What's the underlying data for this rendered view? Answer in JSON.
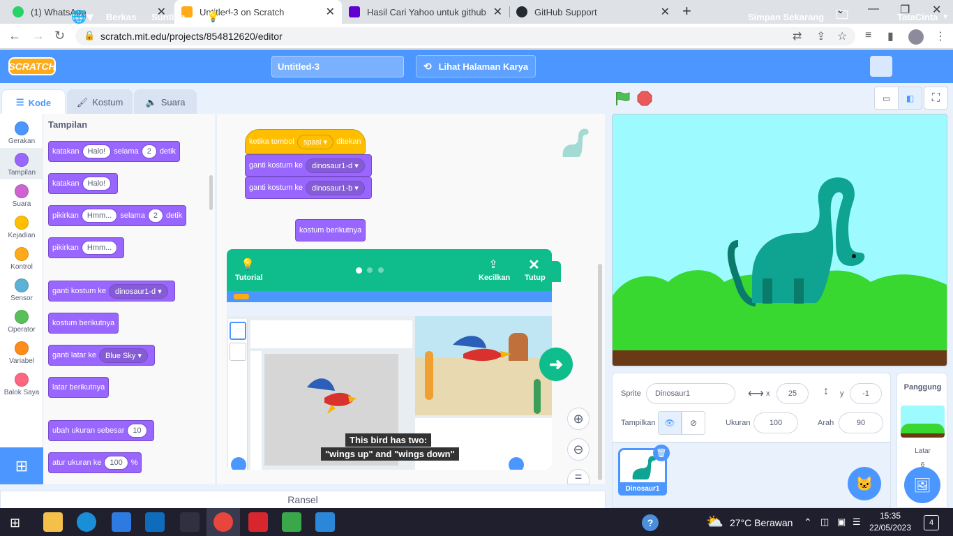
{
  "browser": {
    "tabs": [
      {
        "title": "(1) WhatsApp",
        "color": "#25d366"
      },
      {
        "title": "Untitled-3 on Scratch",
        "color": "#ffab19"
      },
      {
        "title": "Hasil Cari Yahoo untuk github log",
        "color": "#6001d2"
      },
      {
        "title": "GitHub Support",
        "color": "#24292f"
      }
    ],
    "url": "scratch.mit.edu/projects/854812620/editor"
  },
  "menu": {
    "file": "Berkas",
    "edit": "Sunting",
    "tutorial": "Tutorial",
    "project_title": "Untitled-3",
    "see_project": "Lihat Halaman Karya",
    "save_now": "Simpan Sekarang",
    "username": "TataCinta"
  },
  "editor_tabs": {
    "code": "Kode",
    "costume": "Kostum",
    "sound": "Suara"
  },
  "categories": [
    {
      "label": "Gerakan",
      "color": "#4c97ff"
    },
    {
      "label": "Tampilan",
      "color": "#9966ff"
    },
    {
      "label": "Suara",
      "color": "#cf63cf"
    },
    {
      "label": "Kejadian",
      "color": "#ffbf00"
    },
    {
      "label": "Kontrol",
      "color": "#ffab19"
    },
    {
      "label": "Sensor",
      "color": "#5cb1d6"
    },
    {
      "label": "Operator",
      "color": "#59c059"
    },
    {
      "label": "Variabel",
      "color": "#ff8c1a"
    },
    {
      "label": "Balok Saya",
      "color": "#ff6680"
    }
  ],
  "palette": {
    "heading": "Tampilan",
    "say_for": {
      "text": "katakan",
      "value": "Halo!",
      "mid": "selama",
      "secs": "2",
      "unit": "detik"
    },
    "say": {
      "text": "katakan",
      "value": "Halo!"
    },
    "think_for": {
      "text": "pikirkan",
      "value": "Hmm...",
      "mid": "selama",
      "secs": "2",
      "unit": "detik"
    },
    "think": {
      "text": "pikirkan",
      "value": "Hmm..."
    },
    "switch_costume": {
      "text": "ganti kostum ke",
      "value": "dinosaur1-d"
    },
    "next_costume": "kostum berikutnya",
    "switch_backdrop": {
      "text": "ganti latar ke",
      "value": "Blue Sky"
    },
    "next_backdrop": "latar berikutnya",
    "change_size": {
      "text": "ubah ukuran sebesar",
      "value": "10"
    },
    "set_size": {
      "text": "atur ukuran ke",
      "value": "100",
      "unit": "%"
    }
  },
  "script": {
    "hat": {
      "text": "ketika tombol",
      "key": "spasi",
      "suffix": "ditekan"
    },
    "block1": {
      "text": "ganti kostum ke",
      "value": "dinosaur1-d"
    },
    "block2": {
      "text": "ganti kostum ke",
      "value": "dinosaur1-b"
    },
    "loose": "kostum berikutnya"
  },
  "ransel": "Ransel",
  "tutorial_card": {
    "label": "Tutorial",
    "shrink": "Kecilkan",
    "close": "Tutup",
    "caption_line1": "This bird has two:",
    "caption_line2": "\"wings up\" and \"wings down\""
  },
  "sprite_info": {
    "sprite_label": "Sprite",
    "sprite_name": "Dinosaur1",
    "x_label": "x",
    "x": "25",
    "y_label": "y",
    "y": "-1",
    "show_label": "Tampilkan",
    "size_label": "Ukuran",
    "size": "100",
    "direction_label": "Arah",
    "direction": "90"
  },
  "sprite_thumb": "Dinosaur1",
  "stage_pane": {
    "title": "Panggung",
    "backdrop_label": "Latar",
    "backdrop_count": "6"
  },
  "taskbar": {
    "weather": "27°C Berawan",
    "time": "15:35",
    "date": "22/05/2023",
    "notif": "4"
  }
}
